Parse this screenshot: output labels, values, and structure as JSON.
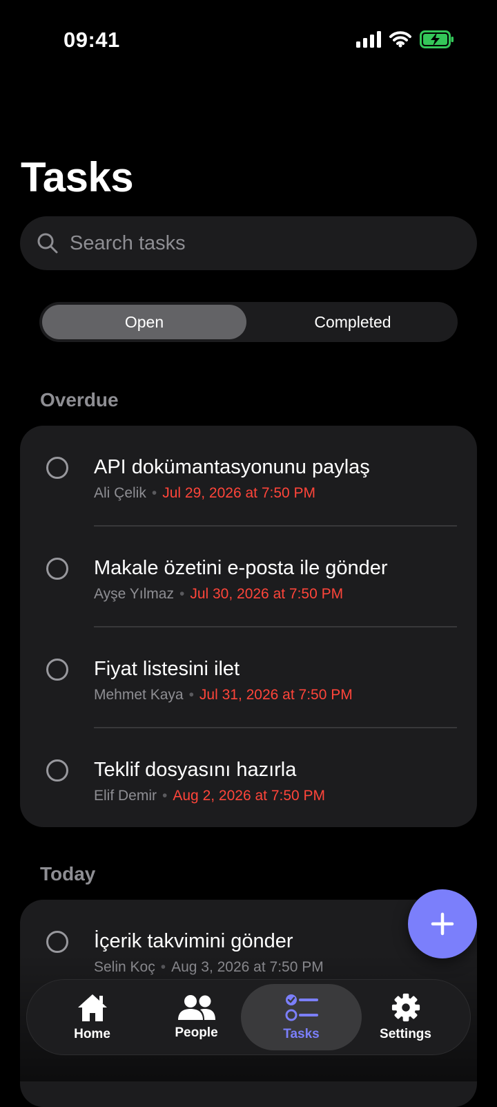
{
  "status_bar": {
    "time": "09:41"
  },
  "page": {
    "title": "Tasks"
  },
  "search": {
    "placeholder": "Search tasks"
  },
  "segments": {
    "open": "Open",
    "completed": "Completed",
    "selected": "Open"
  },
  "sections": {
    "overdue": {
      "label": "Overdue",
      "tasks": [
        {
          "title": "API dokümantasyonunu paylaş",
          "assignee": "Ali Çelik",
          "due": "Jul 29, 2026 at 7:50 PM"
        },
        {
          "title": "Makale özetini e-posta ile gönder",
          "assignee": "Ayşe Yılmaz",
          "due": "Jul 30, 2026 at 7:50 PM"
        },
        {
          "title": "Fiyat listesini ilet",
          "assignee": "Mehmet Kaya",
          "due": "Jul 31, 2026 at 7:50 PM"
        },
        {
          "title": "Teklif dosyasını hazırla",
          "assignee": "Elif Demir",
          "due": "Aug 2, 2026 at 7:50 PM"
        }
      ]
    },
    "today": {
      "label": "Today",
      "tasks": [
        {
          "title": "İçerik takvimini gönder",
          "assignee": "Selin Koç",
          "due": "Aug 3, 2026 at 7:50 PM"
        }
      ]
    }
  },
  "meta_separator": "•",
  "fab": {
    "icon": "plus-icon"
  },
  "tabbar": {
    "items": [
      {
        "label": "Home",
        "icon": "home-icon"
      },
      {
        "label": "People",
        "icon": "people-icon"
      },
      {
        "label": "Tasks",
        "icon": "tasks-icon",
        "active": true
      },
      {
        "label": "Settings",
        "icon": "gear-icon"
      }
    ]
  },
  "colors": {
    "accent": "#7b7ffb",
    "overdue": "#ff453a",
    "card": "#1c1c1e",
    "battery": "#34c759"
  }
}
